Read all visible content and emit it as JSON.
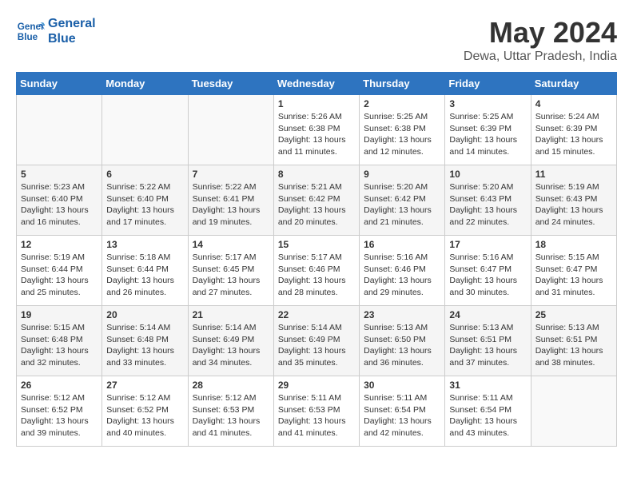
{
  "header": {
    "logo_line1": "General",
    "logo_line2": "Blue",
    "title": "May 2024",
    "subtitle": "Dewa, Uttar Pradesh, India"
  },
  "days_of_week": [
    "Sunday",
    "Monday",
    "Tuesday",
    "Wednesday",
    "Thursday",
    "Friday",
    "Saturday"
  ],
  "weeks": [
    [
      {
        "day": "",
        "info": ""
      },
      {
        "day": "",
        "info": ""
      },
      {
        "day": "",
        "info": ""
      },
      {
        "day": "1",
        "info": "Sunrise: 5:26 AM\nSunset: 6:38 PM\nDaylight: 13 hours and 11 minutes."
      },
      {
        "day": "2",
        "info": "Sunrise: 5:25 AM\nSunset: 6:38 PM\nDaylight: 13 hours and 12 minutes."
      },
      {
        "day": "3",
        "info": "Sunrise: 5:25 AM\nSunset: 6:39 PM\nDaylight: 13 hours and 14 minutes."
      },
      {
        "day": "4",
        "info": "Sunrise: 5:24 AM\nSunset: 6:39 PM\nDaylight: 13 hours and 15 minutes."
      }
    ],
    [
      {
        "day": "5",
        "info": "Sunrise: 5:23 AM\nSunset: 6:40 PM\nDaylight: 13 hours and 16 minutes."
      },
      {
        "day": "6",
        "info": "Sunrise: 5:22 AM\nSunset: 6:40 PM\nDaylight: 13 hours and 17 minutes."
      },
      {
        "day": "7",
        "info": "Sunrise: 5:22 AM\nSunset: 6:41 PM\nDaylight: 13 hours and 19 minutes."
      },
      {
        "day": "8",
        "info": "Sunrise: 5:21 AM\nSunset: 6:42 PM\nDaylight: 13 hours and 20 minutes."
      },
      {
        "day": "9",
        "info": "Sunrise: 5:20 AM\nSunset: 6:42 PM\nDaylight: 13 hours and 21 minutes."
      },
      {
        "day": "10",
        "info": "Sunrise: 5:20 AM\nSunset: 6:43 PM\nDaylight: 13 hours and 22 minutes."
      },
      {
        "day": "11",
        "info": "Sunrise: 5:19 AM\nSunset: 6:43 PM\nDaylight: 13 hours and 24 minutes."
      }
    ],
    [
      {
        "day": "12",
        "info": "Sunrise: 5:19 AM\nSunset: 6:44 PM\nDaylight: 13 hours and 25 minutes."
      },
      {
        "day": "13",
        "info": "Sunrise: 5:18 AM\nSunset: 6:44 PM\nDaylight: 13 hours and 26 minutes."
      },
      {
        "day": "14",
        "info": "Sunrise: 5:17 AM\nSunset: 6:45 PM\nDaylight: 13 hours and 27 minutes."
      },
      {
        "day": "15",
        "info": "Sunrise: 5:17 AM\nSunset: 6:46 PM\nDaylight: 13 hours and 28 minutes."
      },
      {
        "day": "16",
        "info": "Sunrise: 5:16 AM\nSunset: 6:46 PM\nDaylight: 13 hours and 29 minutes."
      },
      {
        "day": "17",
        "info": "Sunrise: 5:16 AM\nSunset: 6:47 PM\nDaylight: 13 hours and 30 minutes."
      },
      {
        "day": "18",
        "info": "Sunrise: 5:15 AM\nSunset: 6:47 PM\nDaylight: 13 hours and 31 minutes."
      }
    ],
    [
      {
        "day": "19",
        "info": "Sunrise: 5:15 AM\nSunset: 6:48 PM\nDaylight: 13 hours and 32 minutes."
      },
      {
        "day": "20",
        "info": "Sunrise: 5:14 AM\nSunset: 6:48 PM\nDaylight: 13 hours and 33 minutes."
      },
      {
        "day": "21",
        "info": "Sunrise: 5:14 AM\nSunset: 6:49 PM\nDaylight: 13 hours and 34 minutes."
      },
      {
        "day": "22",
        "info": "Sunrise: 5:14 AM\nSunset: 6:49 PM\nDaylight: 13 hours and 35 minutes."
      },
      {
        "day": "23",
        "info": "Sunrise: 5:13 AM\nSunset: 6:50 PM\nDaylight: 13 hours and 36 minutes."
      },
      {
        "day": "24",
        "info": "Sunrise: 5:13 AM\nSunset: 6:51 PM\nDaylight: 13 hours and 37 minutes."
      },
      {
        "day": "25",
        "info": "Sunrise: 5:13 AM\nSunset: 6:51 PM\nDaylight: 13 hours and 38 minutes."
      }
    ],
    [
      {
        "day": "26",
        "info": "Sunrise: 5:12 AM\nSunset: 6:52 PM\nDaylight: 13 hours and 39 minutes."
      },
      {
        "day": "27",
        "info": "Sunrise: 5:12 AM\nSunset: 6:52 PM\nDaylight: 13 hours and 40 minutes."
      },
      {
        "day": "28",
        "info": "Sunrise: 5:12 AM\nSunset: 6:53 PM\nDaylight: 13 hours and 41 minutes."
      },
      {
        "day": "29",
        "info": "Sunrise: 5:11 AM\nSunset: 6:53 PM\nDaylight: 13 hours and 41 minutes."
      },
      {
        "day": "30",
        "info": "Sunrise: 5:11 AM\nSunset: 6:54 PM\nDaylight: 13 hours and 42 minutes."
      },
      {
        "day": "31",
        "info": "Sunrise: 5:11 AM\nSunset: 6:54 PM\nDaylight: 13 hours and 43 minutes."
      },
      {
        "day": "",
        "info": ""
      }
    ]
  ]
}
